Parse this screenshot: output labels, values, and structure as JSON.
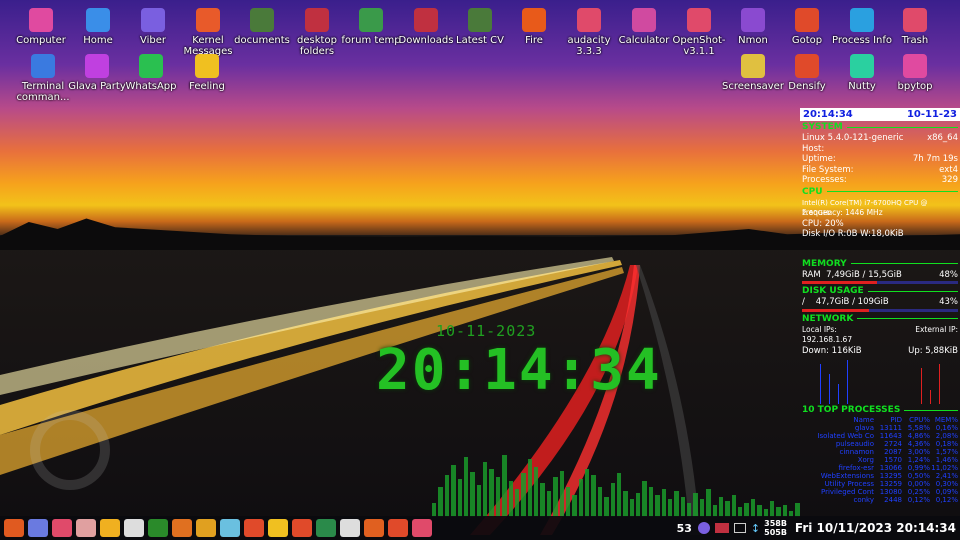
{
  "desktop_icons": [
    {
      "label": "Computer",
      "icon": "monitor-icon",
      "color": "#e04aa0"
    },
    {
      "label": "Home",
      "icon": "home-icon",
      "color": "#3a8ee8"
    },
    {
      "label": "Viber",
      "icon": "viber-icon",
      "color": "#7a5fe0"
    },
    {
      "label": "Kernel Messages",
      "icon": "gear-icon",
      "color": "#e85a2a"
    },
    {
      "label": "documents",
      "icon": "folder-icon",
      "color": "#4a7a3a"
    },
    {
      "label": "desktop folders",
      "icon": "folder-icon",
      "color": "#c03040"
    },
    {
      "label": "forum temp",
      "icon": "folder-icon",
      "color": "#3a9a4a"
    },
    {
      "label": "Downloads",
      "icon": "folder-icon",
      "color": "#c03040"
    },
    {
      "label": "Latest CV",
      "icon": "folder-icon",
      "color": "#4a7a3a"
    },
    {
      "label": "Fire",
      "icon": "fire-icon",
      "color": "#e85a1a"
    },
    {
      "label": "audacity 3.3.3",
      "icon": "audacity-icon",
      "color": "#e04a6a"
    },
    {
      "label": "Calculator",
      "icon": "calculator-icon",
      "color": "#d04aa0"
    },
    {
      "label": "OpenShot-v3.1.1",
      "icon": "openshot-icon",
      "color": "#e04a6a"
    },
    {
      "label": "Nmon",
      "icon": "nmon-icon",
      "color": "#8a4ad0"
    },
    {
      "label": "Gotop",
      "icon": "gotop-icon",
      "color": "#e04a2a"
    },
    {
      "label": "Process Info",
      "icon": "gear-icon",
      "color": "#2aa0e0"
    },
    {
      "label": "Trash",
      "icon": "trash-icon",
      "color": "#e04a6a"
    },
    {
      "label": "Terminal comman...",
      "icon": "document-icon",
      "color": "#3a7ae0"
    },
    {
      "label": "Glava Party",
      "icon": "glava-icon",
      "color": "#c040e0"
    },
    {
      "label": "WhatsApp",
      "icon": "whatsapp-icon",
      "color": "#2ac050"
    },
    {
      "label": "Feeling",
      "icon": "face-icon",
      "color": "#f0c020"
    },
    {
      "label": "Screensaver",
      "icon": "screensaver-icon",
      "color": "#e0c040"
    },
    {
      "label": "Densify",
      "icon": "densify-icon",
      "color": "#e04a2a"
    },
    {
      "label": "Nutty",
      "icon": "nutty-icon",
      "color": "#2ad0a0"
    },
    {
      "label": "bpytop",
      "icon": "bpytop-icon",
      "color": "#e04aa0"
    }
  ],
  "conky": {
    "time": "20:14:34",
    "date": "10-11-23",
    "system_header": "SYSTEM",
    "kernel": "Linux 5.4.0-121-generic",
    "arch": "x86_64",
    "host_label": "Host:",
    "host": "",
    "uptime_label": "Uptime:",
    "uptime": "7h 7m 19s",
    "fs_label": "File System:",
    "fs": "ext4",
    "proc_label": "Processes:",
    "proc": "329",
    "cpu_header": "CPU",
    "cpu_model": "Intel(R) Core(TM) i7-6700HQ CPU @ 2.60GHz",
    "freq": "Frequency: 1446 MHz",
    "cpu_usage": "CPU: 20%",
    "disk_io": "Disk I/O R:0B  W:18,0KiB",
    "memory_header": "MEMORY",
    "ram_label": "RAM",
    "ram": "7,49GiB / 15,5GiB",
    "ram_pct": "48%",
    "ram_frac": 0.48,
    "disk_header": "DISK USAGE",
    "disk_mount": "/",
    "disk": "47,7GiB / 109GiB",
    "disk_pct": "43%",
    "disk_frac": 0.43,
    "network_header": "NETWORK",
    "local_label": "Local IPs:",
    "external_label": "External IP:",
    "local_ip": "192.168.1.67",
    "down": "Down: 116KiB",
    "up": "Up: 5,88KiB",
    "top_header": "10 TOP PROCESSES",
    "proc_cols": [
      "Name",
      "PID",
      "CPU%",
      "MEM%"
    ],
    "procs": [
      [
        "glava",
        "13111",
        "5,58%",
        "0,16%"
      ],
      [
        "Isolated Web Co",
        "11643",
        "4,86%",
        "2,08%"
      ],
      [
        "pulseaudio",
        "2724",
        "4,36%",
        "0,18%"
      ],
      [
        "cinnamon",
        "2087",
        "3,00%",
        "1,57%"
      ],
      [
        "Xorg",
        "1570",
        "1,24%",
        "1,46%"
      ],
      [
        "firefox-esr",
        "13066",
        "0,99%",
        "11,02%"
      ],
      [
        "WebExtensions",
        "13295",
        "0,50%",
        "2,41%"
      ],
      [
        "Utility Process",
        "13259",
        "0,00%",
        "0,30%"
      ],
      [
        "Privileged Cont",
        "13080",
        "0,25%",
        "0,09%"
      ],
      [
        "conky",
        "2448",
        "0,12%",
        "0,12%"
      ]
    ]
  },
  "desk_clock": {
    "date": "10-11-2023",
    "time": "20:14:34"
  },
  "visualizer": [
    14,
    30,
    42,
    52,
    38,
    60,
    45,
    32,
    55,
    48,
    40,
    62,
    36,
    28,
    44,
    58,
    50,
    34,
    26,
    40,
    46,
    30,
    22,
    38,
    48,
    42,
    30,
    20,
    34,
    44,
    26,
    18,
    24,
    36,
    30,
    22,
    28,
    18,
    26,
    20,
    14,
    24,
    18,
    28,
    12,
    20,
    16,
    22,
    10,
    14,
    18,
    12,
    8,
    16,
    10,
    12,
    6,
    14
  ],
  "taskbar": {
    "icons": [
      "ubuntu-menu-icon",
      "files-icon",
      "stack-icon",
      "cards-icon",
      "mail-icon",
      "keyboard-icon",
      "dashed-square-icon",
      "pinwheel-icon",
      "terminal-money-icon",
      "music-icon",
      "terminal-icon",
      "bolt-icon",
      "terminal-icon",
      "inkscape-icon",
      "clock-icon",
      "firefox-icon",
      "firefox-alt-icon",
      "display-icon"
    ],
    "tray_count": "53",
    "net_up": "358B",
    "net_down": "505B",
    "datetime": "Fri 10/11/2023 20:14:34"
  }
}
